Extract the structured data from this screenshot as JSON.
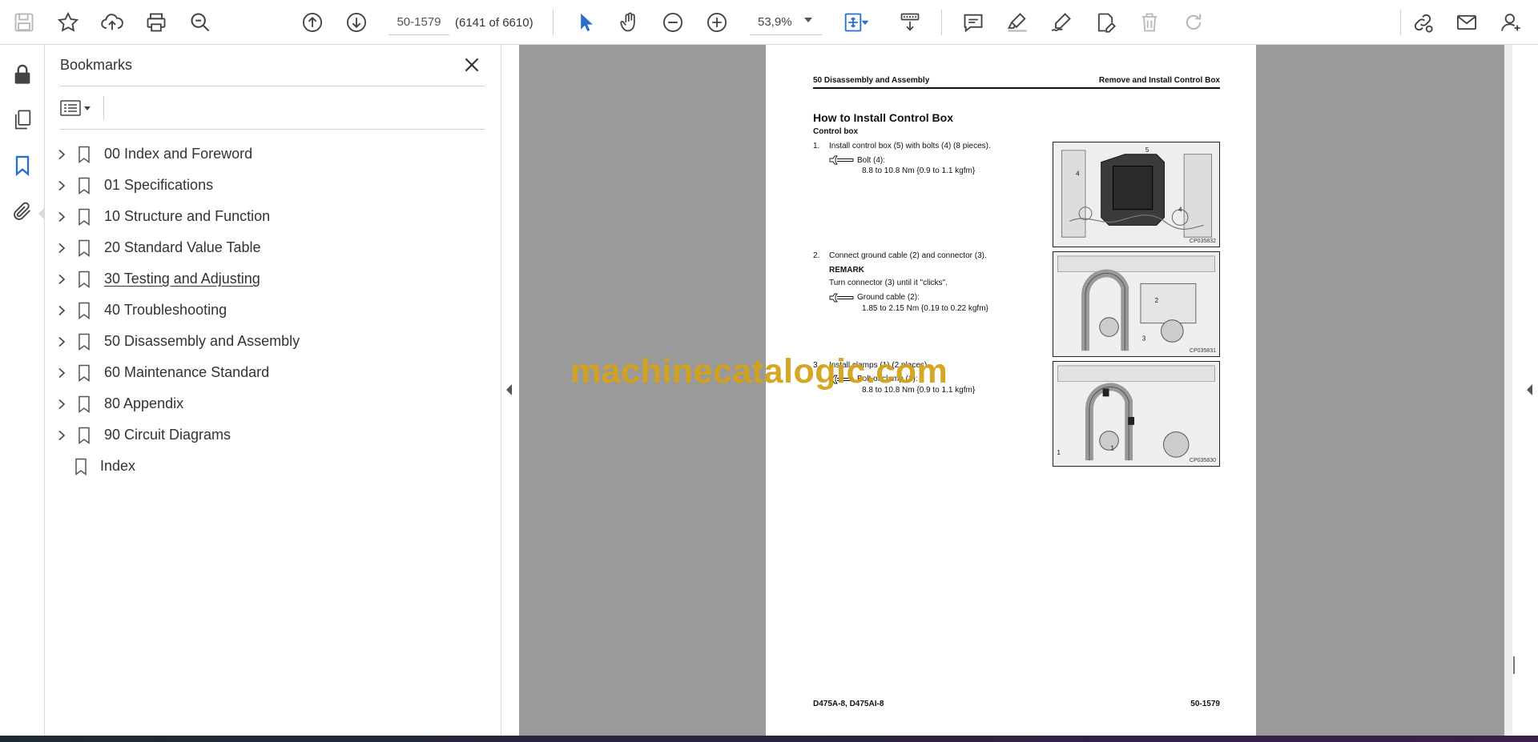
{
  "toolbar": {
    "page_input_value": "50-1579",
    "page_count": "(6141 of 6610)",
    "zoom_value": "53,9%",
    "icons": [
      "save-icon",
      "star-icon",
      "upload-icon",
      "print-icon",
      "search-zoom-icon",
      "page-up-icon",
      "page-down-icon",
      "select-arrow-icon",
      "hand-icon",
      "zoom-out-icon",
      "zoom-in-icon",
      "fit-page-icon",
      "scroll-mode-icon",
      "comment-icon",
      "highlight-icon",
      "sign-icon",
      "edit-text-icon",
      "delete-icon",
      "redo-icon",
      "share-link-icon",
      "mail-icon",
      "account-icon"
    ]
  },
  "rail": {
    "icons": [
      "lock-icon",
      "pages-icon",
      "bookmark-icon",
      "attachment-icon"
    ]
  },
  "bookmarks": {
    "title": "Bookmarks",
    "items": [
      {
        "label": "00 Index and Foreword",
        "expandable": true
      },
      {
        "label": "01 Specifications",
        "expandable": true
      },
      {
        "label": "10 Structure and Function",
        "expandable": true
      },
      {
        "label": "20 Standard Value Table",
        "expandable": true
      },
      {
        "label": "30 Testing and Adjusting",
        "expandable": true
      },
      {
        "label": "40 Troubleshooting",
        "expandable": true
      },
      {
        "label": "50 Disassembly and Assembly",
        "expandable": true
      },
      {
        "label": "60 Maintenance Standard",
        "expandable": true
      },
      {
        "label": "80 Appendix",
        "expandable": true
      },
      {
        "label": "90 Circuit Diagrams",
        "expandable": true
      },
      {
        "label": "Index",
        "expandable": false
      }
    ]
  },
  "document": {
    "header_left": "50 Disassembly and Assembly",
    "header_right": "Remove and Install Control Box",
    "title": "How to Install Control Box",
    "subtitle": "Control box",
    "step1": {
      "num": "1.",
      "text": "Install control box (5) with bolts (4) (8 pieces).",
      "torque_label": "Bolt (4):",
      "torque_value": "8.8 to 10.8 Nm {0.9 to 1.1 kgfm}"
    },
    "step2": {
      "num": "2.",
      "text": "Connect ground cable (2) and connector (3).",
      "remark_label": "REMARK",
      "remark_text": "Turn connector (3) until it \"clicks\".",
      "torque_label": "Ground cable (2):",
      "torque_value": "1.85 to 2.15 Nm {0.19 to 0.22 kgfm}"
    },
    "step3": {
      "num": "3.",
      "text": "Install clamps (1) (2 places).",
      "torque_label": "Bolt of clamp (1):",
      "torque_value": "8.8 to 10.8 Nm {0.9 to 1.1 kgfm}"
    },
    "figures": [
      {
        "code": "CP035832",
        "callouts": [
          "5",
          "4",
          "4"
        ]
      },
      {
        "code": "CP035831",
        "callouts": [
          "2",
          "3"
        ]
      },
      {
        "code": "CP035830",
        "callouts": [
          "1",
          "1"
        ]
      }
    ],
    "footer_left": "D475A-8, D475AI-8",
    "footer_right": "50-1579"
  },
  "watermark": "machinecatalogic.com",
  "colors": {
    "accent_blue": "#2a6fcf",
    "watermark": "#d4a21a",
    "viewer_gray": "#9a9a9a"
  }
}
